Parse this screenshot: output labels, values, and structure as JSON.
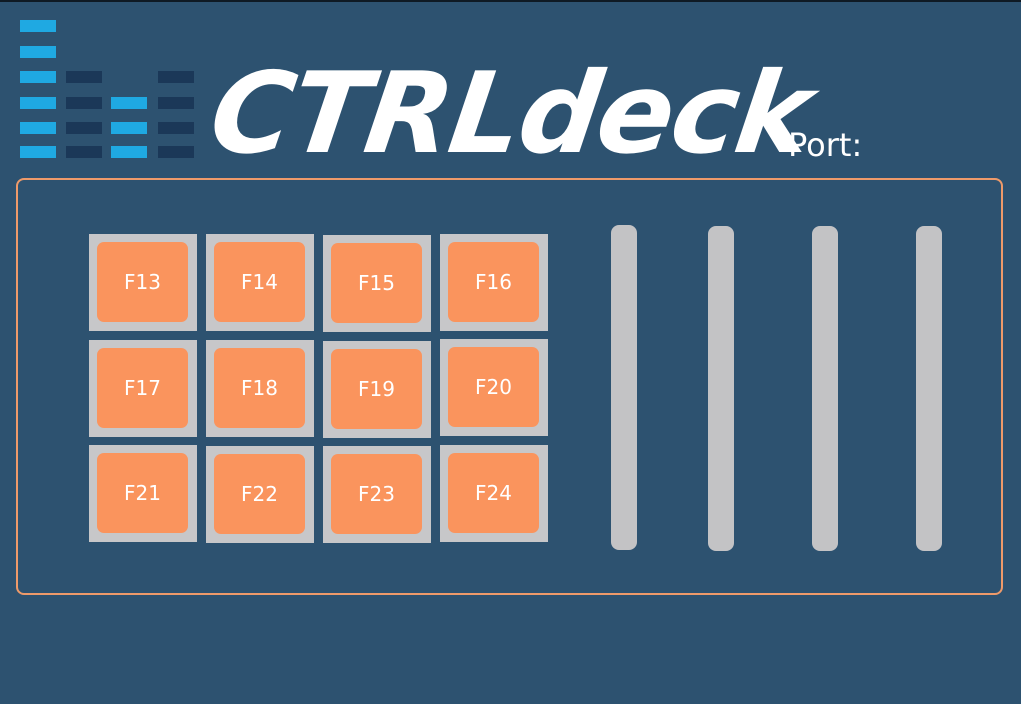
{
  "logo": {
    "text": "CTRLdeck",
    "icon": "equalizer-bars-icon"
  },
  "port": {
    "label": "Port:"
  },
  "colors": {
    "background": "#2d5270",
    "accent_border": "#ee9a6a",
    "pad": "#fa945d",
    "pad_frame": "#c7c7c9",
    "slider": "#c3c3c5",
    "eq_on": "#1fa9e2",
    "eq_off": "#1b3858"
  },
  "pads": [
    {
      "label": "F13"
    },
    {
      "label": "F14"
    },
    {
      "label": "F15"
    },
    {
      "label": "F16"
    },
    {
      "label": "F17"
    },
    {
      "label": "F18"
    },
    {
      "label": "F19"
    },
    {
      "label": "F20"
    },
    {
      "label": "F21"
    },
    {
      "label": "F22"
    },
    {
      "label": "F23"
    },
    {
      "label": "F24"
    }
  ],
  "sliders": [
    {
      "name": "slider-1"
    },
    {
      "name": "slider-2"
    },
    {
      "name": "slider-3"
    },
    {
      "name": "slider-4"
    }
  ]
}
